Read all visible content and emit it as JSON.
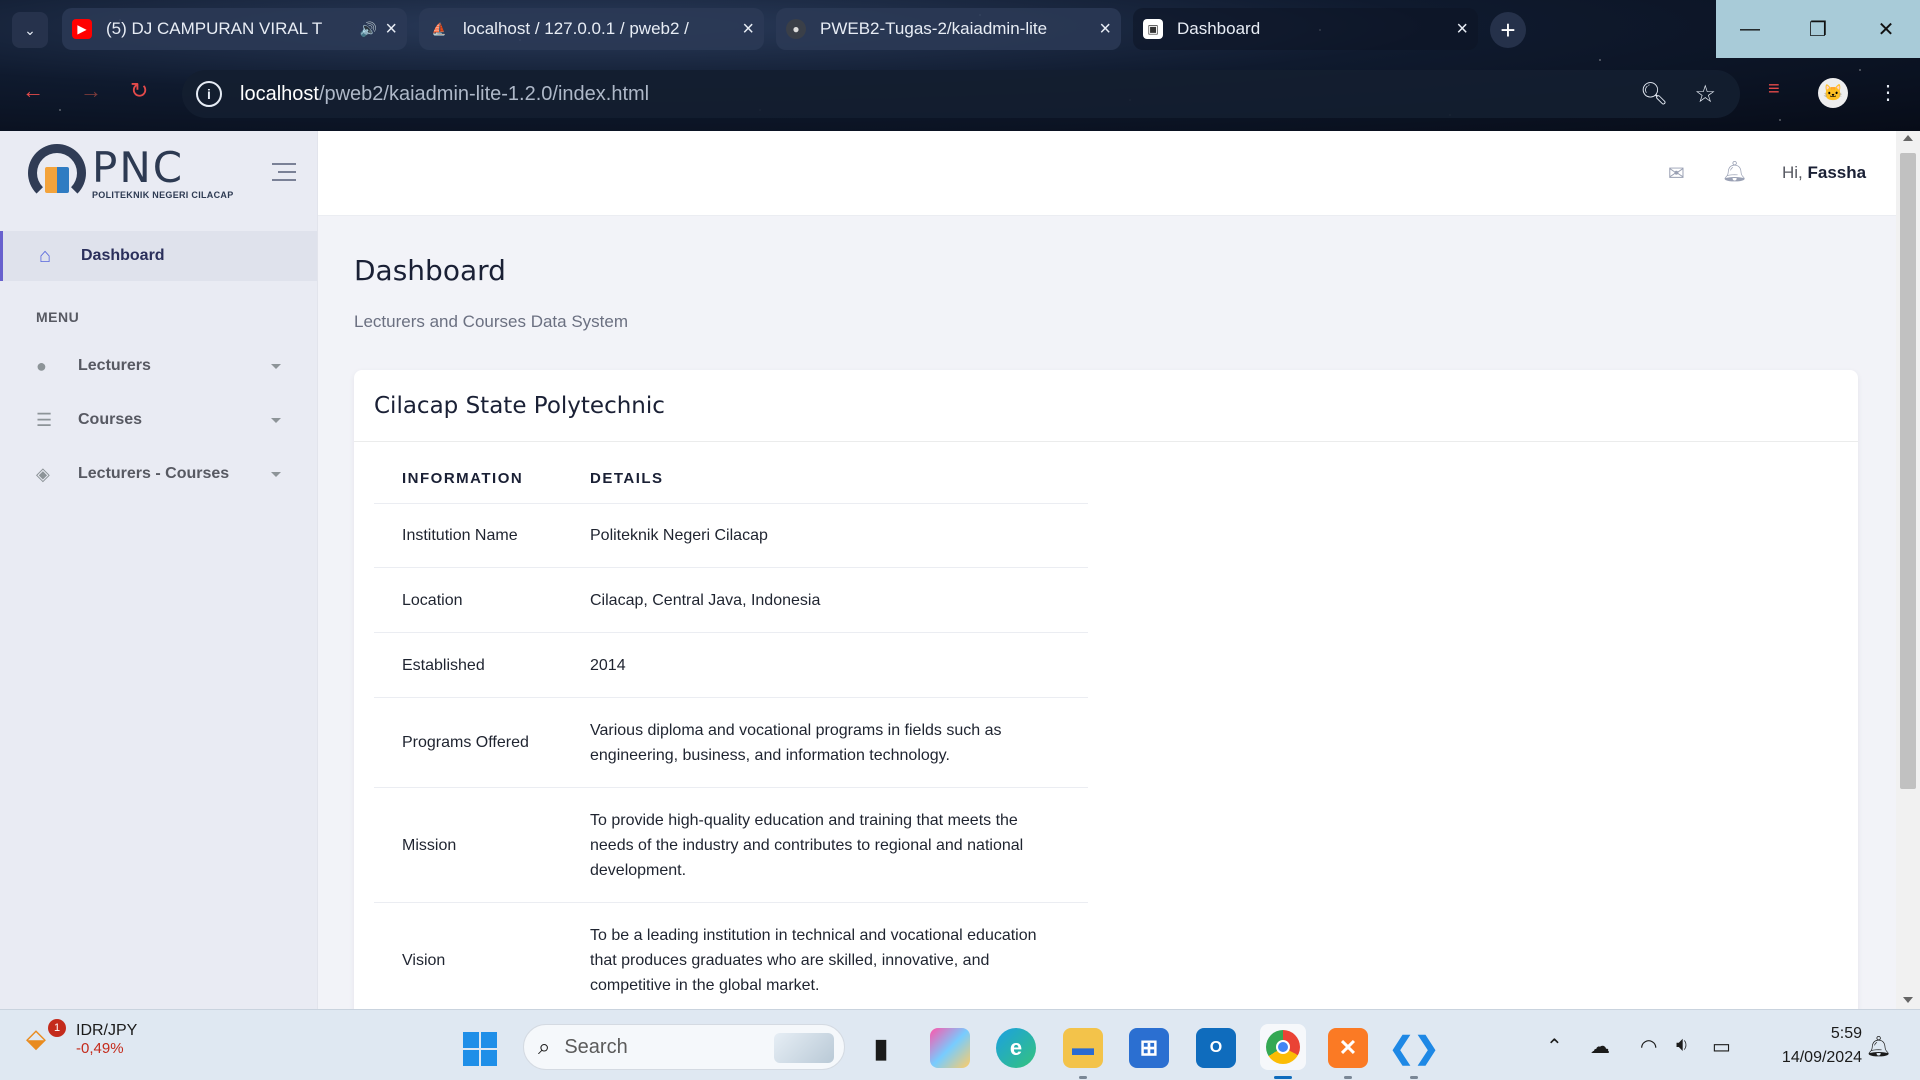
{
  "browser": {
    "tabs": [
      {
        "title": "(5) DJ CAMPURAN VIRAL T",
        "icon": "youtube-icon",
        "playing": true
      },
      {
        "title": "localhost / 127.0.0.1 / pweb2 /",
        "icon": "phpmyadmin-icon"
      },
      {
        "title": "PWEB2-Tugas-2/kaiadmin-lite",
        "icon": "github-icon"
      },
      {
        "title": "Dashboard",
        "icon": "page-icon",
        "active": true
      }
    ],
    "url_host": "localhost",
    "url_path": "/pweb2/kaiadmin-lite-1.2.0/index.html"
  },
  "sidebar": {
    "logo_text": "PNC",
    "logo_subtext": "POLITEKNIK NEGERI CILACAP",
    "active_item": "Dashboard",
    "section_title": "MENU",
    "items": [
      {
        "label": "Lecturers",
        "icon": "user-icon"
      },
      {
        "label": "Courses",
        "icon": "list-icon"
      },
      {
        "label": "Lecturers - Courses",
        "icon": "layers-icon"
      }
    ]
  },
  "topbar": {
    "greeting": "Hi,",
    "username": "Fassha"
  },
  "main": {
    "title": "Dashboard",
    "subtitle": "Lecturers and Courses Data System",
    "card_title": "Cilacap State Polytechnic",
    "table": {
      "headers": [
        "INFORMATION",
        "DETAILS"
      ],
      "rows": [
        [
          "Institution Name",
          "Politeknik Negeri Cilacap"
        ],
        [
          "Location",
          "Cilacap, Central Java, Indonesia"
        ],
        [
          "Established",
          "2014"
        ],
        [
          "Programs Offered",
          "Various diploma and vocational programs in fields such as engineering, business, and information technology."
        ],
        [
          "Mission",
          "To provide high-quality education and training that meets the needs of the industry and contributes to regional and national development."
        ],
        [
          "Vision",
          "To be a leading institution in technical and vocational education that produces graduates who are skilled, innovative, and competitive in the global market."
        ]
      ]
    }
  },
  "taskbar": {
    "widget_title": "IDR/JPY",
    "widget_value": "-0,49%",
    "widget_badge": "1",
    "search_placeholder": "Search",
    "time": "5:59",
    "date": "14/09/2024"
  },
  "colors": {
    "accent": "#5867dd",
    "sidebar_bg": "#e9ebf3",
    "page_bg": "#f2f3f8",
    "negative": "#c42b1c"
  }
}
